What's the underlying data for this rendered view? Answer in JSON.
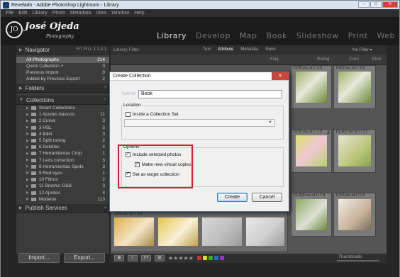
{
  "titlebar": {
    "title": "Revelado - Adobe Photoshop Lightroom - Library",
    "min": "–",
    "max": "□",
    "close": "✕"
  },
  "menubar": [
    "File",
    "Edit",
    "Library",
    "Photo",
    "Metadata",
    "View",
    "Window",
    "Help"
  ],
  "identity": {
    "logo_mark": "JO",
    "name": "José Ojeda",
    "sub": "Photography"
  },
  "modules": [
    "Library",
    "Develop",
    "Map",
    "Book",
    "Slideshow",
    "Print",
    "Web"
  ],
  "left_panel": {
    "navigator": {
      "label": "Navigator",
      "zoom": "FIT  FILL  1:1  4:1"
    },
    "catalog": [
      {
        "label": "All Photographs",
        "count": "214"
      },
      {
        "label": "Quick Collection +",
        "count": "0"
      },
      {
        "label": "Previous Import",
        "count": "0"
      },
      {
        "label": "Added by Previous Export",
        "count": "2"
      }
    ],
    "folders": {
      "label": "Folders",
      "add": "+"
    },
    "collections": {
      "label": "Collections",
      "add": "+",
      "items": [
        {
          "label": "Smart Collections",
          "count": ""
        },
        {
          "label": "1 Ajustes basicos",
          "count": "11"
        },
        {
          "label": "2 Curva",
          "count": "3"
        },
        {
          "label": "3 HSL",
          "count": "5"
        },
        {
          "label": "4 B&N",
          "count": "3"
        },
        {
          "label": "5 Split toning",
          "count": "2"
        },
        {
          "label": "6 Detalles",
          "count": "4"
        },
        {
          "label": "7 Herramientas Crop",
          "count": "1"
        },
        {
          "label": "7 Lens correction",
          "count": "3"
        },
        {
          "label": "8 Herramientas Spots",
          "count": "3"
        },
        {
          "label": "9 Red eyes",
          "count": "1"
        },
        {
          "label": "10 Filtros",
          "count": "2"
        },
        {
          "label": "11 Brocha: D&B",
          "count": "3"
        },
        {
          "label": "12 Ajustes",
          "count": "4"
        },
        {
          "label": "Modelos",
          "count": "113"
        }
      ]
    },
    "publish": {
      "label": "Publish Services",
      "add": "+"
    }
  },
  "buttons": {
    "import": "Import...",
    "export": "Export..."
  },
  "filterbar": {
    "label": "Library Filter :",
    "tabs": [
      "Text",
      "Attribute",
      "Metadata",
      "None"
    ],
    "active": "Attribute",
    "nofilter": "No Filter ▾",
    "flag": "Flag",
    "rating": "Rating",
    "color": "Color",
    "kind": "Kind"
  },
  "grid": {
    "cells": [
      {
        "exif": "1/200 sec at f / 2.8",
        "num": ""
      },
      {
        "exif": "1/200 sec at f / 1.8",
        "num": "2"
      },
      {
        "exif": "1/1,600 sec at f / 1.8",
        "num": ""
      },
      {
        "exif": "1/200 sec at f / 2.8",
        "num": ""
      },
      {
        "exif": "1/1,600 sec at f / 3.5",
        "num": ""
      },
      {
        "exif": "1/200 sec at f / 2.8",
        "num": ""
      },
      {
        "exif": "1/200 sec at f / 2.8",
        "num": ""
      },
      {
        "exif": "1/1,600 sec at f / 2.8",
        "num": ""
      }
    ]
  },
  "toolbar": {
    "stars": "★★★★★",
    "thumbnails": "Thumbnails"
  },
  "dialog": {
    "title": "Create Collection",
    "name_label": "Name:",
    "name_value": "Book",
    "location_label": "Location",
    "inside_set": "Inside a Collection Set",
    "options_label": "Options",
    "include_selected": "Include selected photos",
    "make_virtual": "Make new virtual copies",
    "set_target": "Set as target collection",
    "create": "Create",
    "cancel": "Cancel",
    "close": "✕"
  },
  "colors": {
    "highlight": "#d7202e",
    "accent_button": "#3c7fb1"
  }
}
